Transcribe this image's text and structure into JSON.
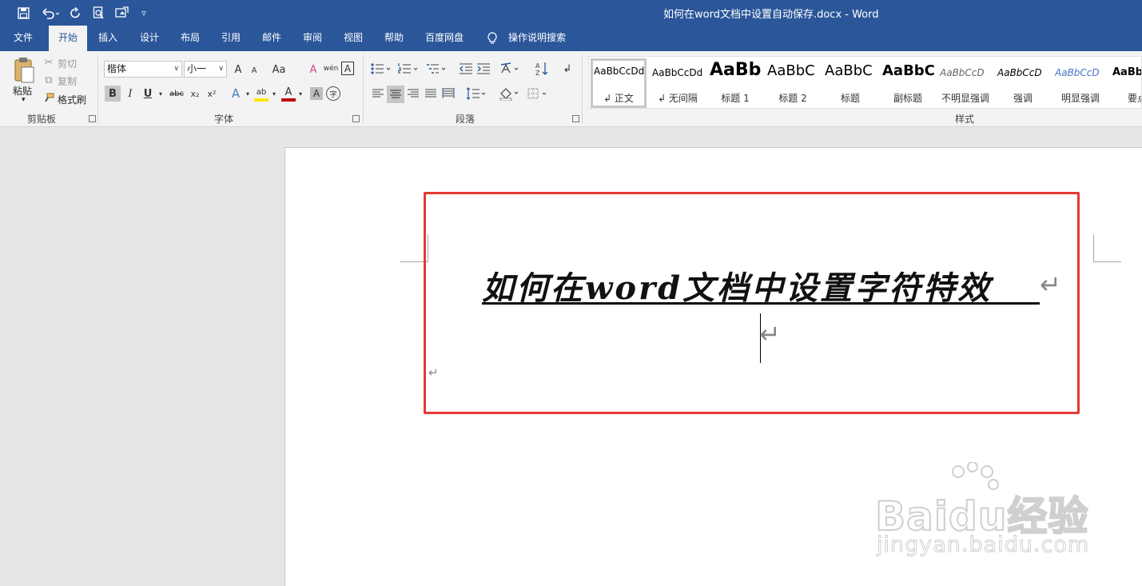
{
  "app": {
    "document_title": "如何在word文档中设置自动保存.docx  -  Word"
  },
  "quick_access": [
    {
      "name": "save-icon",
      "glyph": "💾"
    },
    {
      "name": "undo-icon",
      "glyph": "↶"
    },
    {
      "name": "redo-icon",
      "glyph": "↻"
    },
    {
      "name": "print-preview-icon",
      "glyph": "🔍"
    },
    {
      "name": "touch-mode-icon",
      "glyph": "✎"
    },
    {
      "name": "customize-qat-icon",
      "glyph": "▿"
    }
  ],
  "tabs": [
    "文件",
    "开始",
    "插入",
    "设计",
    "布局",
    "引用",
    "邮件",
    "审阅",
    "视图",
    "帮助",
    "百度网盘"
  ],
  "tell_me": "操作说明搜索",
  "clipboard": {
    "paste": "粘贴",
    "cut": "剪切",
    "copy": "复制",
    "format_painter": "格式刷",
    "group_label": "剪贴板"
  },
  "font": {
    "family": "楷体",
    "size": "小一",
    "grow": "A",
    "shrink": "A",
    "case": "Aa",
    "clear": "A",
    "phonetic": "wén",
    "border_char": "A",
    "bold": "B",
    "italic": "I",
    "underline": "U",
    "strike": "abc",
    "subscript": "x₂",
    "superscript": "x²",
    "effects": "A",
    "highlight": "ab",
    "color": "A",
    "shading": "A",
    "enclose": "字",
    "group_label": "字体"
  },
  "paragraph": {
    "group_label": "段落"
  },
  "styles": {
    "group_label": "样式",
    "items": [
      {
        "preview": "AaBbCcDd",
        "name": "↲ 正文"
      },
      {
        "preview": "AaBbCcDd",
        "name": "↲ 无间隔"
      },
      {
        "preview": "AaBb",
        "name": "标题 1"
      },
      {
        "preview": "AaBbC",
        "name": "标题 2"
      },
      {
        "preview": "AaBbC",
        "name": "标题"
      },
      {
        "preview": "AaBbC",
        "name": "副标题"
      },
      {
        "preview": "AaBbCcD",
        "name": "不明显强调"
      },
      {
        "preview": "AaBbCcD",
        "name": "强调"
      },
      {
        "preview": "AaBbCcD",
        "name": "明显强调"
      },
      {
        "preview": "AaBbC",
        "name": "要点"
      }
    ]
  },
  "document": {
    "heading": "如何在word文档中设置字符特效",
    "paragraph_mark": "↵"
  },
  "watermark": {
    "brand": "Baidu经验",
    "site": "jingyan.baidu.com"
  },
  "colors": {
    "accent": "#2b579a",
    "highlight_box": "#e53935"
  }
}
